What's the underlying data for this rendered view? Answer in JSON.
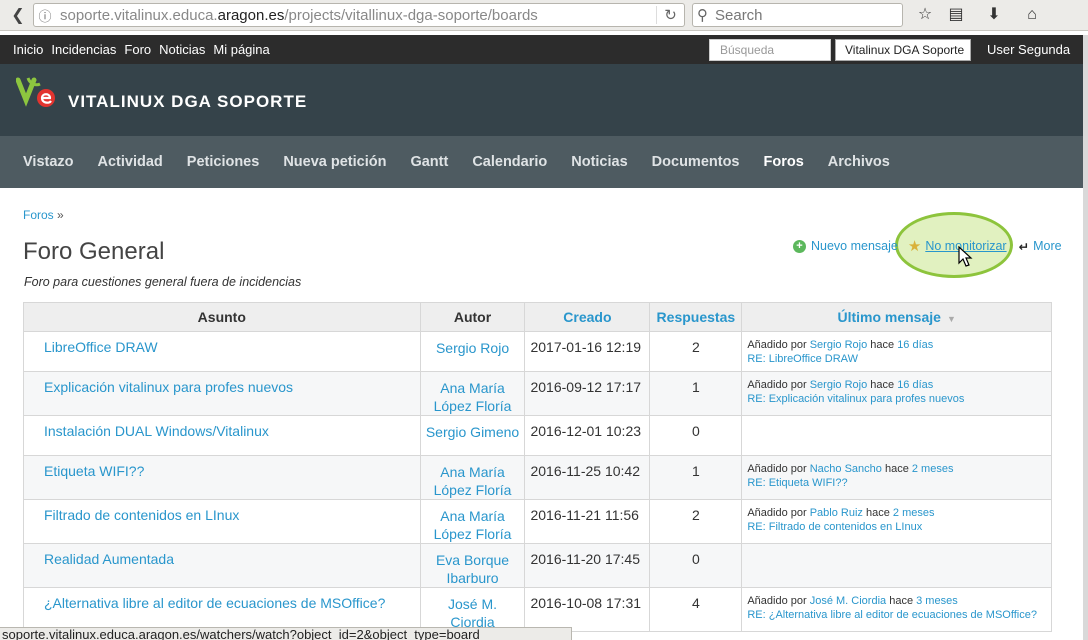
{
  "browser": {
    "url_prefix": "soporte.vitalinux.educa.",
    "url_domain": "aragon.es",
    "url_path": "/projects/vitallinux-dga-soporte/boards",
    "search_placeholder": "Search"
  },
  "top_menu": {
    "links": [
      "Inicio",
      "Incidencias",
      "Foro",
      "Noticias",
      "Mi página"
    ],
    "search_placeholder": "Búsqueda",
    "project_select": "Vitalinux DGA Soporte",
    "user": "User Segunda"
  },
  "header": {
    "title": "VITALINUX DGA SOPORTE"
  },
  "main_menu": {
    "items": [
      "Vistazo",
      "Actividad",
      "Peticiones",
      "Nueva petición",
      "Gantt",
      "Calendario",
      "Noticias",
      "Documentos",
      "Foros",
      "Archivos"
    ],
    "selected": "Foros"
  },
  "breadcrumb": {
    "link": "Foros",
    "sep": "»"
  },
  "page": {
    "title": "Foro General",
    "description": "Foro para cuestiones general fuera de incidencias"
  },
  "actions": {
    "new_message": "Nuevo mensaje",
    "unwatch": "No monitorizar",
    "more": "More"
  },
  "table": {
    "headers": {
      "subject": "Asunto",
      "author": "Autor",
      "created": "Creado",
      "replies": "Respuestas",
      "last": "Último mensaje"
    },
    "rows": [
      {
        "subject": "LibreOffice DRAW",
        "author1": "Sergio Rojo",
        "author2": "",
        "created": "2017-01-16 12:19",
        "replies": "2",
        "last_prefix": "Añadido por",
        "last_author": "Sergio Rojo",
        "last_mid": "hace",
        "last_ago": "16 días",
        "last_link": "RE: LibreOffice DRAW"
      },
      {
        "subject": "Explicación vitalinux para profes nuevos",
        "author1": "Ana María",
        "author2": "López Floría",
        "created": "2016-09-12 17:17",
        "replies": "1",
        "last_prefix": "Añadido por",
        "last_author": "Sergio Rojo",
        "last_mid": "hace",
        "last_ago": "16 días",
        "last_link": "RE: Explicación vitalinux para profes nuevos"
      },
      {
        "subject": "Instalación DUAL Windows/Vitalinux",
        "author1": "Sergio Gimeno",
        "author2": "",
        "created": "2016-12-01 10:23",
        "replies": "0",
        "last_prefix": "",
        "last_author": "",
        "last_mid": "",
        "last_ago": "",
        "last_link": ""
      },
      {
        "subject": "Etiqueta WIFI??",
        "author1": "Ana María",
        "author2": "López Floría",
        "created": "2016-11-25 10:42",
        "replies": "1",
        "last_prefix": "Añadido por",
        "last_author": "Nacho Sancho",
        "last_mid": "hace",
        "last_ago": "2 meses",
        "last_link": "RE: Etiqueta WIFI??"
      },
      {
        "subject": "Filtrado de contenidos en LInux",
        "author1": "Ana María",
        "author2": "López Floría",
        "created": "2016-11-21 11:56",
        "replies": "2",
        "last_prefix": "Añadido por",
        "last_author": "Pablo Ruiz",
        "last_mid": "hace",
        "last_ago": "2 meses",
        "last_link": "RE: Filtrado de contenidos en LInux"
      },
      {
        "subject": "Realidad Aumentada",
        "author1": "Eva Borque",
        "author2": "Ibarburo",
        "created": "2016-11-20 17:45",
        "replies": "0",
        "last_prefix": "",
        "last_author": "",
        "last_mid": "",
        "last_ago": "",
        "last_link": ""
      },
      {
        "subject": "¿Alternativa libre al editor de ecuaciones de MSOffice?",
        "author1": "José M.",
        "author2": "Ciordia",
        "created": "2016-10-08 17:31",
        "replies": "4",
        "last_prefix": "Añadido por",
        "last_author": "José M. Ciordia",
        "last_mid": "hace",
        "last_ago": "3 meses",
        "last_link": "RE: ¿Alternativa libre al editor de ecuaciones de MSOffice?"
      }
    ]
  },
  "status_bar": "soporte.vitalinux.educa.aragon.es/watchers/watch?object_id=2&object_type=board"
}
